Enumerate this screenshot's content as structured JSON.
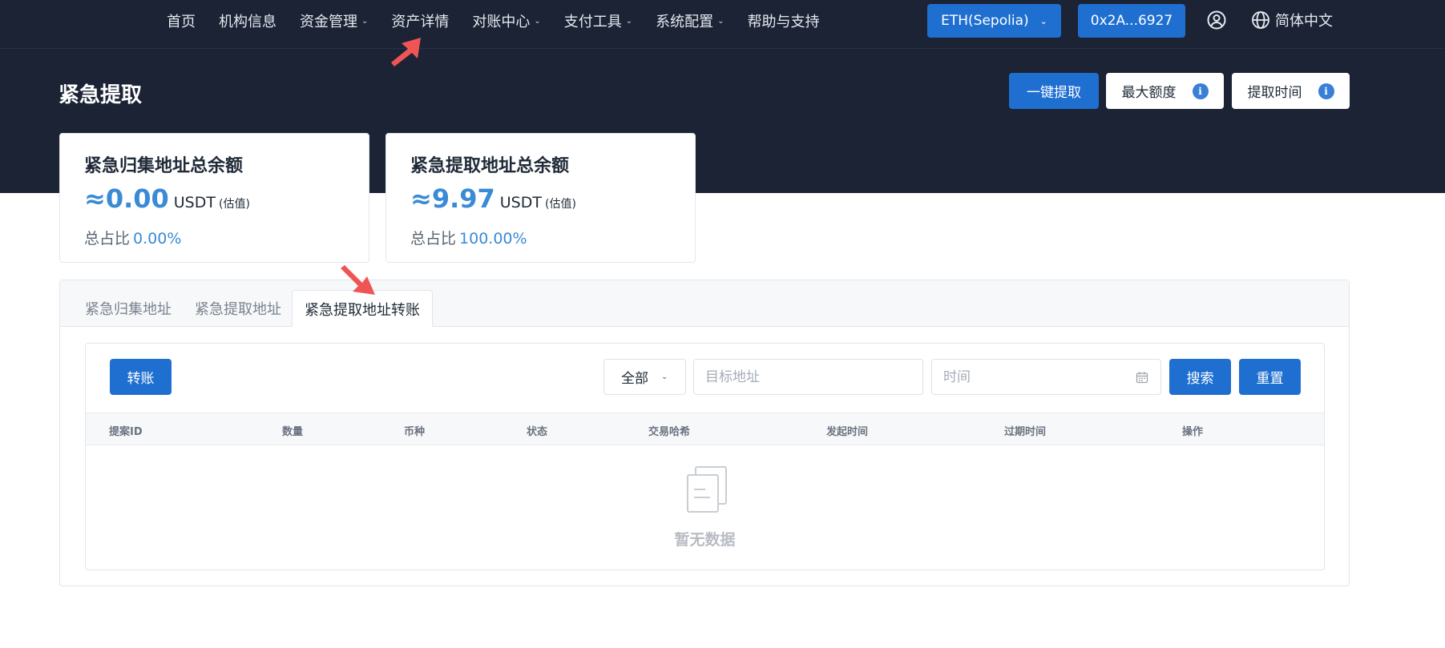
{
  "nav": {
    "items": [
      {
        "label": "首页",
        "dropdown": false
      },
      {
        "label": "机构信息",
        "dropdown": false
      },
      {
        "label": "资金管理",
        "dropdown": true
      },
      {
        "label": "资产详情",
        "dropdown": false
      },
      {
        "label": "对账中心",
        "dropdown": true
      },
      {
        "label": "支付工具",
        "dropdown": true
      },
      {
        "label": "系统配置",
        "dropdown": true
      },
      {
        "label": "帮助与支持",
        "dropdown": false
      }
    ],
    "network": "ETH(Sepolia)",
    "address": "0x2A...6927",
    "language": "简体中文"
  },
  "page": {
    "title": "紧急提取",
    "actions": {
      "oneclick": "一键提取",
      "max_amount": "最大额度",
      "withdraw_time": "提取时间"
    }
  },
  "cards": [
    {
      "title": "紧急归集地址总余额",
      "amount": "≈0.00",
      "unit": "USDT",
      "note": "(估值)",
      "ratio_label": "总占比",
      "ratio_value": "0.00%"
    },
    {
      "title": "紧急提取地址总余额",
      "amount": "≈9.97",
      "unit": "USDT",
      "note": "(估值)",
      "ratio_label": "总占比",
      "ratio_value": "100.00%"
    }
  ],
  "tabs": [
    "紧急归集地址",
    "紧急提取地址",
    "紧急提取地址转账"
  ],
  "active_tab": 2,
  "toolbar": {
    "transfer": "转账",
    "filter_value": "全部",
    "address_placeholder": "目标地址",
    "time_placeholder": "时间",
    "search": "搜索",
    "reset": "重置"
  },
  "table": {
    "columns": [
      "提案ID",
      "数量",
      "币种",
      "状态",
      "交易哈希",
      "发起时间",
      "过期时间",
      "操作"
    ],
    "rows": [],
    "empty_text": "暂无数据"
  },
  "colors": {
    "header_bg": "#1b2335",
    "primary": "#1f6fd1",
    "accent_text": "#3a8ad6",
    "annotation_arrow": "#f05555"
  }
}
